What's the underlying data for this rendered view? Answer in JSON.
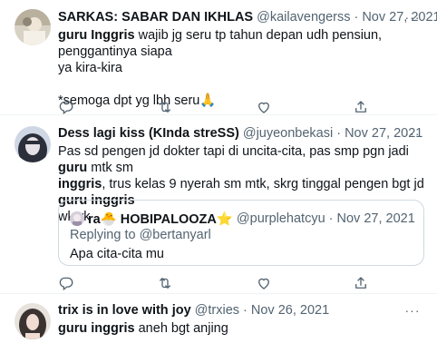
{
  "tweets": [
    {
      "name": "SARKAS: SABAR DAN IKHLAS",
      "handle": "@kailavengerss",
      "sep": "·",
      "date": "Nov 27, 2021",
      "line1_bold": "guru Inggris",
      "line1_rest": " wajib jg seru tp tahun depan udh pensiun, penggantinya siapa",
      "line2": "ya kira-kira",
      "line3": "*semoga dpt yg lbh seru🙏"
    },
    {
      "name": "Dess lagi kiss (KInda streSS)",
      "handle": "@juyeonbekasi",
      "sep": "·",
      "date": "Nov 27, 2021",
      "line1_pre": "Pas sd pengen jd dokter tapi di uncita-cita, pas smp pgn jadi ",
      "line1_bold": "guru",
      "line1_post": " mtk sm",
      "line2_bold": "inggris",
      "line2_mid": ", trus kelas 9 nyerah sm mtk, skrg tinggal pengen bgt jd ",
      "line2_bold2": "guru inggris",
      "line3": "wkwk",
      "quote": {
        "name": "ra🐣 HOBIPALOOZA⭐",
        "handle": "@purplehatcyu",
        "sep": "·",
        "date": "Nov 27, 2021",
        "replying_label": "Replying to ",
        "replying_handle": "@bertanyarl",
        "text": "Apa cita-cita mu"
      }
    },
    {
      "name": "trix is in love with joy",
      "handle": "@trxies",
      "sep": "·",
      "date": "Nov 26, 2021",
      "line1_bold": "guru inggris",
      "line1_rest": " aneh bgt anjing"
    }
  ],
  "more_label": "···",
  "icons": [
    "reply-icon",
    "retweet-icon",
    "like-icon",
    "share-icon"
  ],
  "colors": {
    "text": "#0f1419",
    "secondary": "#536471",
    "border": "#cfd9de",
    "divider": "#eff3f4"
  }
}
